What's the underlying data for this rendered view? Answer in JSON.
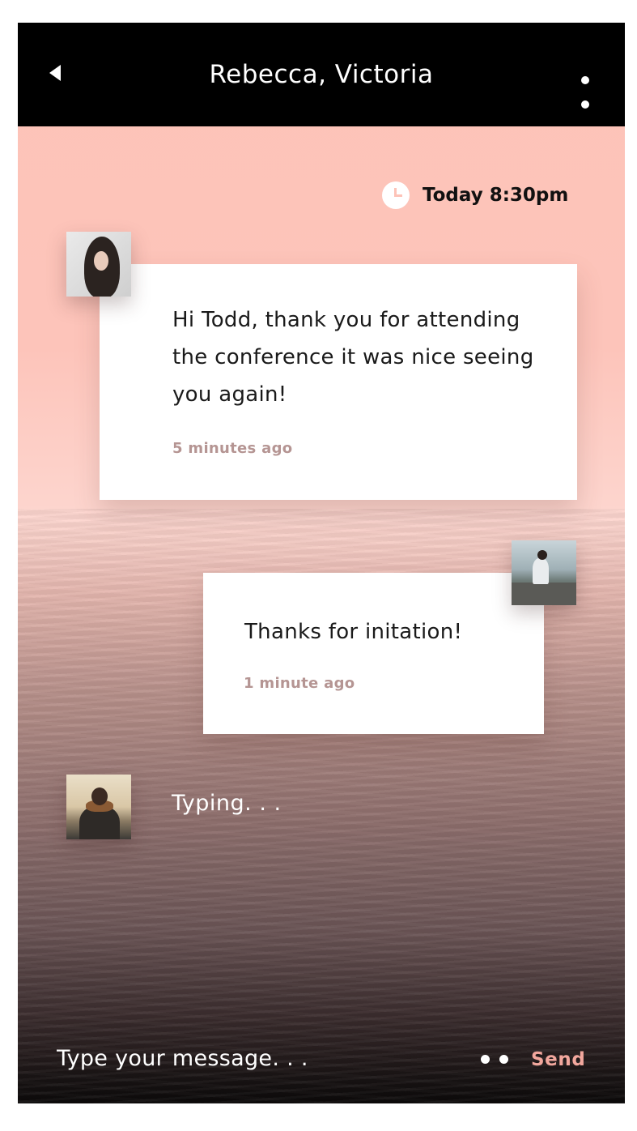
{
  "header": {
    "title": "Rebecca, Victoria",
    "back_icon": "back-arrow-icon",
    "menu_icon": "more-vertical-icon"
  },
  "conversation": {
    "timestamp": "Today 8:30pm",
    "messages": [
      {
        "sender_avatar": "rebecca-avatar",
        "text": "Hi Todd, thank you for attending the conference it was nice seeing you again!",
        "time": "5 minutes ago"
      },
      {
        "sender_avatar": "todd-avatar",
        "text": "Thanks for initation!",
        "time": "1 minute ago"
      }
    ],
    "typing": "Typing. . ."
  },
  "composer": {
    "placeholder": "Type your message. . .",
    "emoji_icon": "emoji-icon",
    "send_label": "Send"
  },
  "colors": {
    "accent": "#f2a79d",
    "header_bg": "#000000",
    "bubble_bg": "#ffffff",
    "meta_text": "#b59593"
  }
}
